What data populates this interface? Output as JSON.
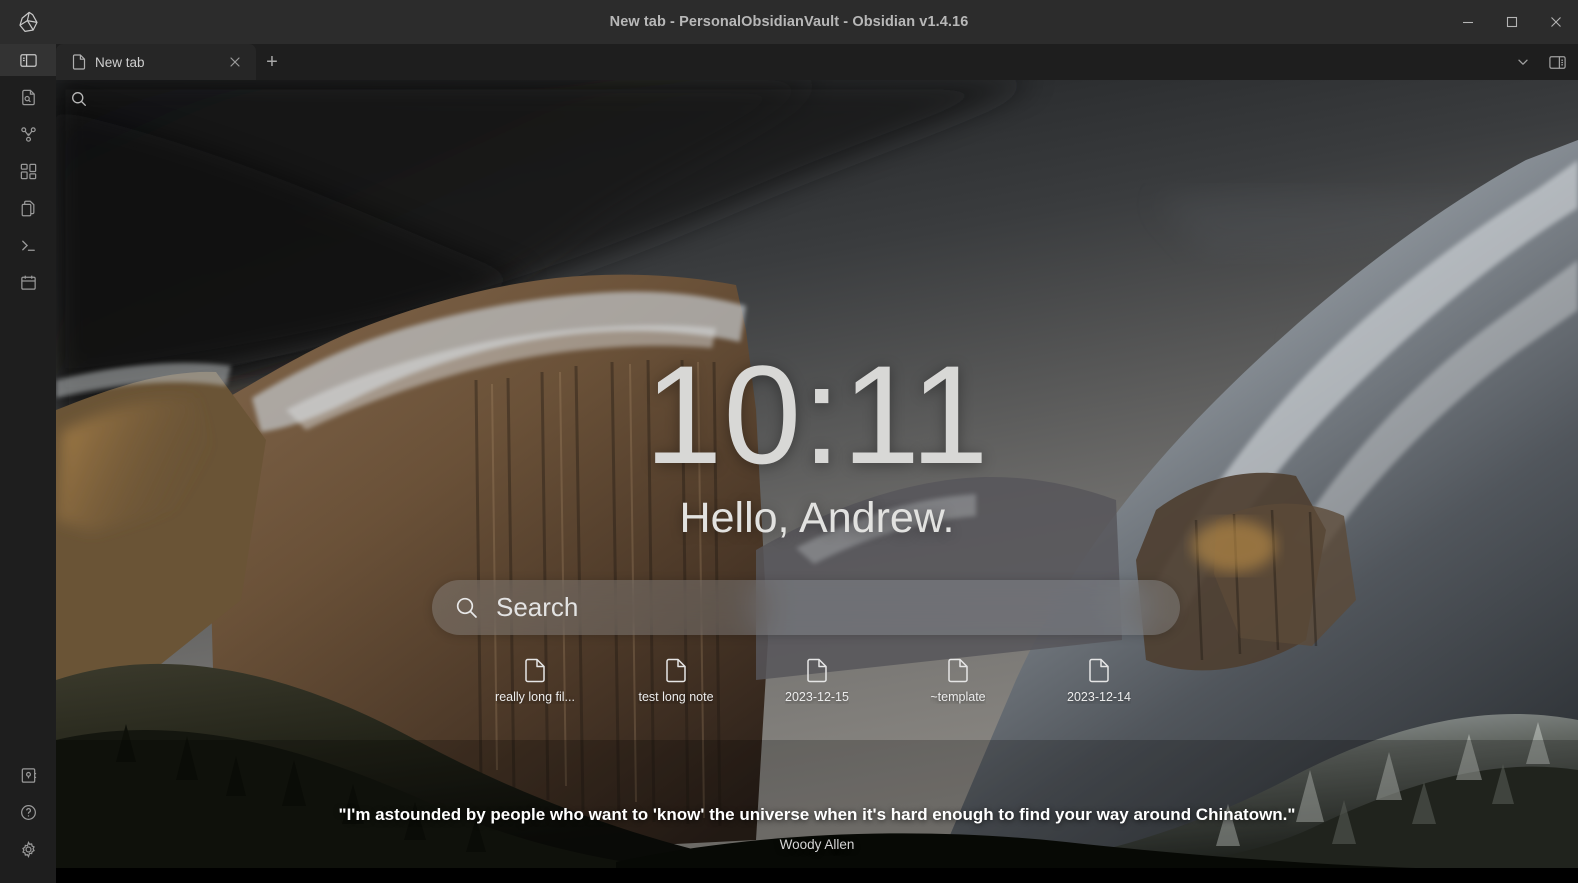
{
  "window": {
    "title": "New tab - PersonalObsidianVault - Obsidian v1.4.16",
    "app_name": "Obsidian",
    "vault_name": "PersonalObsidianVault",
    "version": "v1.4.16",
    "controls": {
      "minimize": "minimize",
      "maximize": "maximize",
      "close": "close"
    },
    "logo_icon": "obsidian-gem-icon"
  },
  "ribbon": {
    "top_items": [
      {
        "icon": "toggle-left-sidebar-icon",
        "label": "Toggle left sidebar",
        "active": true
      },
      {
        "icon": "file-search-icon",
        "label": "Search in file",
        "active": false
      },
      {
        "icon": "graph-view-icon",
        "label": "Open graph view",
        "active": false
      },
      {
        "icon": "canvas-grid-icon",
        "label": "Create new canvas",
        "active": false
      },
      {
        "icon": "copy-files-icon",
        "label": "Open another window",
        "active": false
      },
      {
        "icon": "terminal-icon",
        "label": "Open terminal",
        "active": false
      },
      {
        "icon": "calendar-icon",
        "label": "Open calendar",
        "active": false
      }
    ],
    "bottom_items": [
      {
        "icon": "vault-switcher-icon",
        "label": "Open another vault"
      },
      {
        "icon": "help-icon",
        "label": "Help"
      },
      {
        "icon": "settings-gear-icon",
        "label": "Settings"
      }
    ]
  },
  "tabbar": {
    "tabs": [
      {
        "icon": "document-icon",
        "label": "New tab",
        "close_icon": "close-icon",
        "active": true
      }
    ],
    "new_tab_label": "+",
    "right_controls": [
      {
        "icon": "chevron-down-icon",
        "label": "Tab list"
      },
      {
        "icon": "toggle-right-sidebar-icon",
        "label": "Toggle right sidebar"
      }
    ]
  },
  "content": {
    "search_icon": "search-icon"
  },
  "home": {
    "clock": "10:11",
    "greeting": "Hello, Andrew.",
    "search": {
      "icon": "search-icon",
      "placeholder": "Search",
      "value": ""
    },
    "shortcuts": [
      {
        "icon": "document-icon",
        "label": "really long fil..."
      },
      {
        "icon": "document-icon",
        "label": "test long note"
      },
      {
        "icon": "document-icon",
        "label": "2023-12-15"
      },
      {
        "icon": "document-icon",
        "label": "~template"
      },
      {
        "icon": "document-icon",
        "label": "2023-12-14"
      }
    ],
    "quote": {
      "text": "\"I'm astounded by people who want to 'know' the universe when it's hard enough to find your way around Chinatown.\"",
      "author": "Woody Allen"
    }
  },
  "colors": {
    "titlebar_bg": "#2c2c2c",
    "ribbon_bg": "#1e1e1e",
    "tab_active_bg": "#262626",
    "text_primary": "#dcddde",
    "text_muted": "#999999"
  }
}
